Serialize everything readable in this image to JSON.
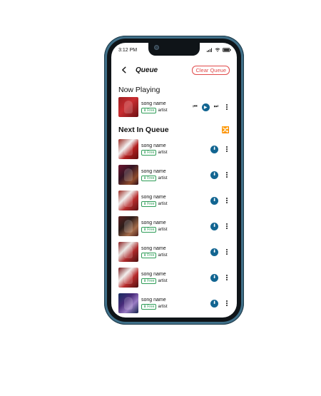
{
  "status_bar": {
    "time": "3:12 PM"
  },
  "header": {
    "title": "Queue",
    "clear_label": "Clear Queue"
  },
  "now_playing": {
    "heading": "Now Playing",
    "track": {
      "song": "song name",
      "badge": "Free",
      "artist": "artist"
    }
  },
  "queue": {
    "heading": "Next In Queue",
    "items": [
      {
        "song": "song name",
        "badge": "Free",
        "artist": "artist"
      },
      {
        "song": "song name",
        "badge": "Free",
        "artist": "artist"
      },
      {
        "song": "song name",
        "badge": "Free",
        "artist": "artist"
      },
      {
        "song": "song name",
        "badge": "Free",
        "artist": "artist"
      },
      {
        "song": "song name",
        "badge": "Free",
        "artist": "artist"
      },
      {
        "song": "song name",
        "badge": "Free",
        "artist": "artist"
      },
      {
        "song": "song name",
        "badge": "Free",
        "artist": "artist"
      }
    ]
  },
  "icons": {
    "back": "back-arrow-icon",
    "previous": "previous-track-icon",
    "play": "play-icon",
    "next": "next-track-icon",
    "more": "more-vertical-icon",
    "shuffle": "shuffle-icon",
    "download": "download-icon",
    "free_download": "download-small-icon",
    "signal": "signal-icon",
    "wifi": "wifi-icon",
    "battery": "battery-icon"
  },
  "colors": {
    "phone_frame": "#3f6f88",
    "accent": "#126591",
    "clear_button": "#e04a4a",
    "free_badge": "#2f9d58"
  }
}
